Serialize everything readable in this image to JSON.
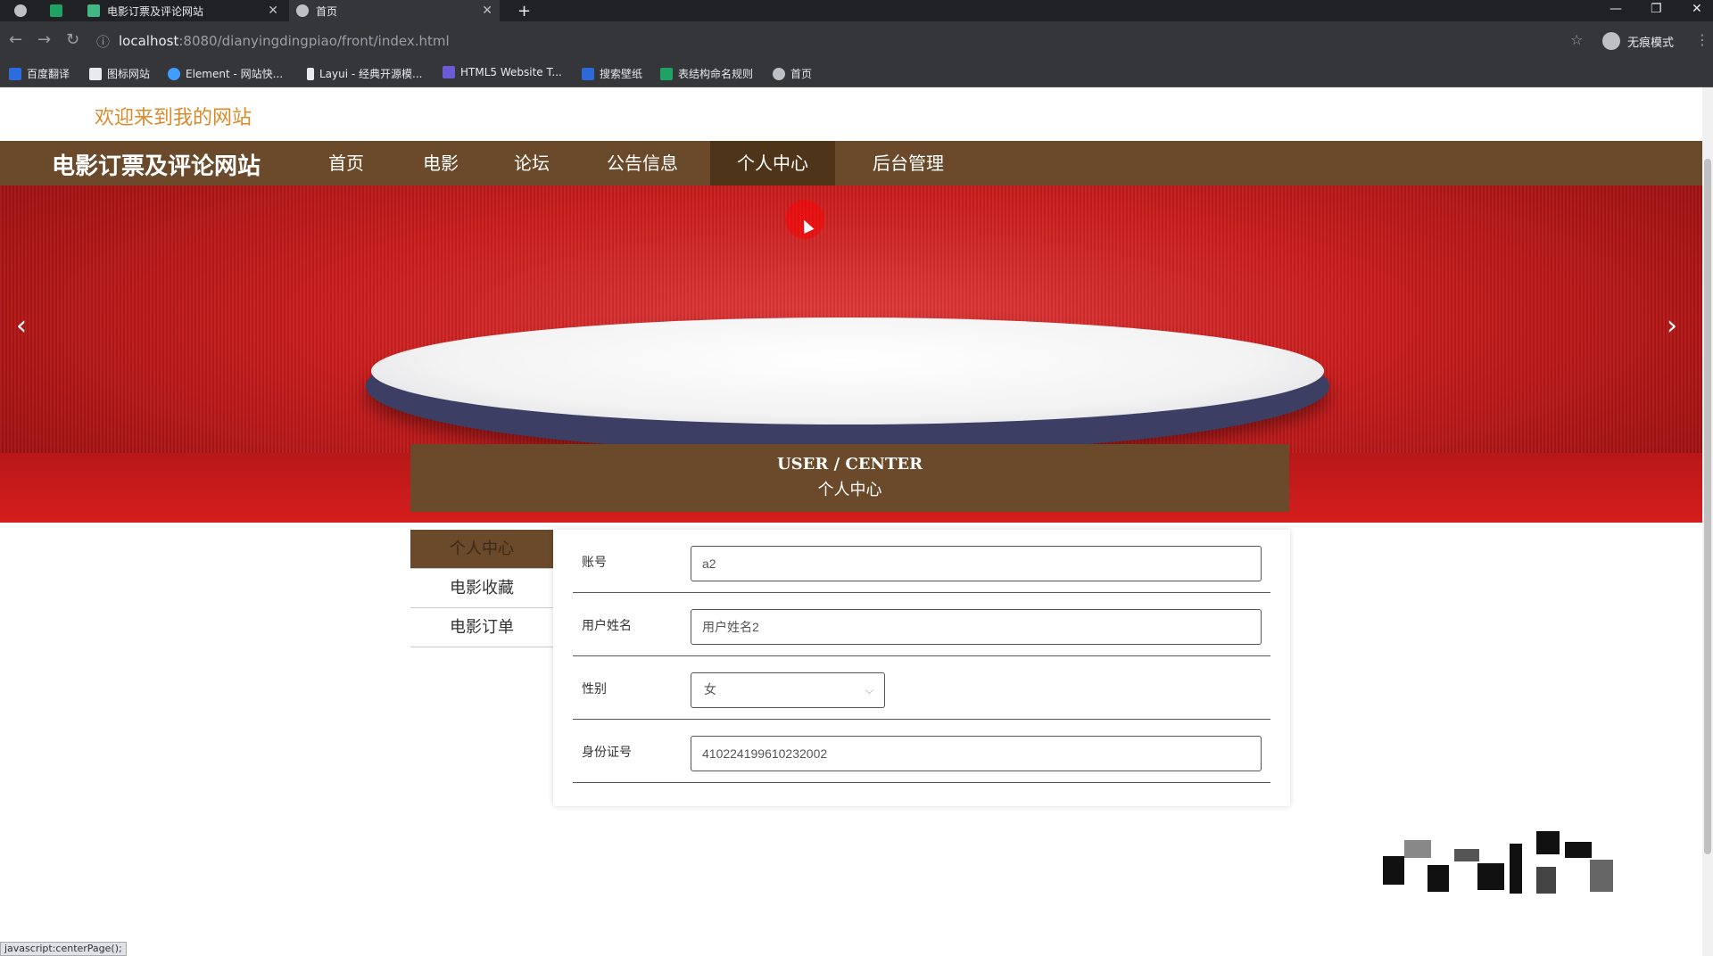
{
  "browser": {
    "tabs": [
      {
        "label": ""
      },
      {
        "label": "电影订票及评论网站"
      },
      {
        "label": "首页"
      }
    ],
    "new_tab": "+",
    "url_host": "localhost",
    "url_path": ":8080/dianyingdingpiao/front/index.html",
    "profile_label": "无痕模式",
    "bookmarks": [
      "百度翻译",
      "图标网站",
      "Element - 网站快...",
      "Layui - 经典开源模...",
      "HTML5 Website T...",
      "搜索壁纸",
      "表结构命名规则",
      "首页"
    ]
  },
  "site": {
    "welcome": "欢迎来到我的网站",
    "brand": "电影订票及评论网站",
    "nav": [
      "首页",
      "电影",
      "论坛",
      "公告信息",
      "个人中心",
      "后台管理"
    ],
    "active_nav_index": 4,
    "carousel": {
      "slide_count": 3,
      "active_index": 0
    }
  },
  "center": {
    "title_en": "USER / CENTER",
    "title_cn": "个人中心",
    "sidebar": [
      "个人中心",
      "电影收藏",
      "电影订单"
    ],
    "form": {
      "account_label": "账号",
      "account_value": "a2",
      "name_label": "用户姓名",
      "name_value": "用户姓名2",
      "gender_label": "性别",
      "gender_value": "女",
      "id_label": "身份证号",
      "id_value": "410224199610232002"
    }
  },
  "statusbar": "javascript:centerPage();",
  "colors": {
    "nav_bg": "#6a4a2a",
    "welcome": "#d98b2b",
    "banner": "#c81b1b"
  }
}
